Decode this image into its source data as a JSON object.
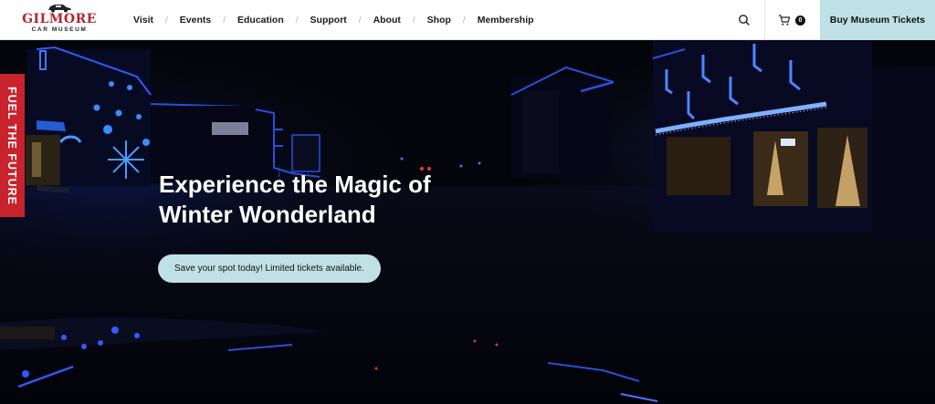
{
  "header": {
    "logo": {
      "name": "GILMORE",
      "subtitle": "CAR MUSEUM"
    },
    "nav": [
      {
        "label": "Visit"
      },
      {
        "label": "Events"
      },
      {
        "label": "Education"
      },
      {
        "label": "Support"
      },
      {
        "label": "About"
      },
      {
        "label": "Shop"
      },
      {
        "label": "Membership"
      }
    ],
    "nav_separator": "/",
    "search_icon": "search-icon",
    "cart": {
      "icon": "cart-icon",
      "count": "0"
    },
    "cta_label": "Buy Museum Tickets"
  },
  "hero": {
    "title_line1": "Experience the Magic of",
    "title_line2": "Winter Wonderland",
    "cta_label": "Save your spot today! Limited tickets available.",
    "side_tab": "FUEL THE FUTURE"
  },
  "colors": {
    "brand_red": "#c8232c",
    "accent_light_blue": "#bfe1e6",
    "hero_bg": "#05060c",
    "neon_blue": "#2f5bff"
  }
}
